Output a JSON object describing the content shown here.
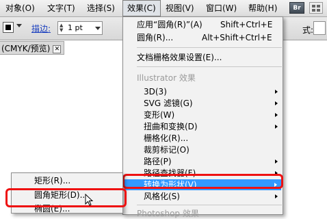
{
  "menubar": {
    "items": [
      "对象(O)",
      "文字(T)",
      "选择(S)",
      "效果(C)",
      "视图(V)",
      "窗口(W)",
      "帮助(H)"
    ],
    "br_label": "Br"
  },
  "toolbar": {
    "stroke_label": "描边:",
    "stroke_value": "1 pt",
    "style_label": "式:"
  },
  "document_tab": {
    "label": "(CMYK/预览)",
    "close": "✕"
  },
  "effect_menu": {
    "apply_label": "应用“圆角(R)”(A)",
    "apply_shortcut": "Shift+Ctrl+E",
    "roundcorner_label": "圆角(R)...",
    "roundcorner_shortcut": "Alt+Shift+Ctrl+E",
    "raster_settings": "文档栅格效果设置(E)...",
    "illustrator_header": "Illustrator 效果",
    "items": [
      "3D(3)",
      "SVG 滤镜(G)",
      "变形(W)",
      "扭曲和变换(D)",
      "栅格化(R)...",
      "裁剪标记(O)",
      "路径(P)",
      "路径查找器(F)",
      "转换为形状(V)",
      "风格化(S)"
    ],
    "photoshop_header": "Photoshop 效果"
  },
  "shape_submenu": {
    "items": [
      "矩形(R)...",
      "圆角矩形(D)...",
      "椭圆(E)..."
    ]
  },
  "colors": {
    "highlight": "#3399ff",
    "annotation_red": "#ee1111",
    "stroke_label_blue": "#1a3fbf"
  }
}
